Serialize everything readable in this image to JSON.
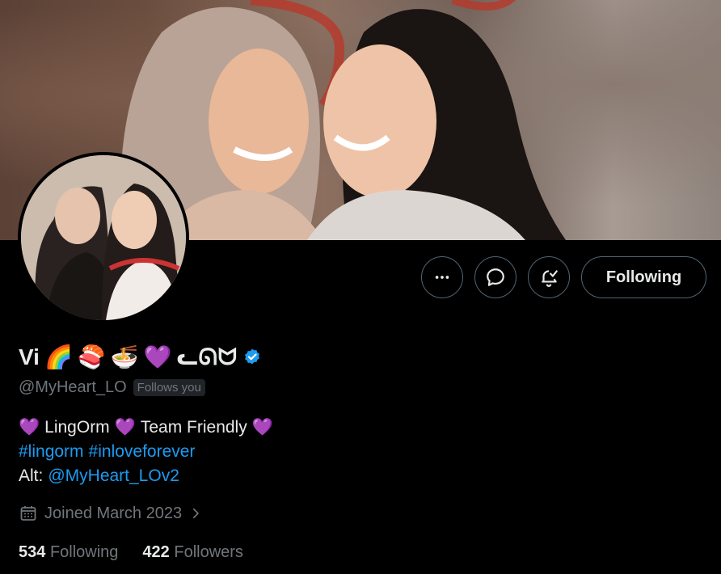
{
  "profile": {
    "name": "Vi",
    "name_emojis": [
      "🌈",
      "🍣",
      "🍜",
      "💜"
    ],
    "name_suffix": "ᓚᘏᗢ",
    "verified": true,
    "handle": "@MyHeart_LO",
    "follows_you": "Follows you",
    "bio": {
      "line1_left_heart": "💜",
      "line1_a": "LingOrm",
      "line1_mid_heart": "💜",
      "line1_b": "Team Friendly",
      "line1_right_heart": "💜",
      "hashtag1": "#lingorm",
      "hashtag2": "#inloveforever",
      "alt_label": "Alt:",
      "alt_handle": "@MyHeart_LOv2"
    },
    "joined": "Joined March 2023",
    "following_count": "534",
    "following_label": "Following",
    "followers_count": "422",
    "followers_label": "Followers"
  },
  "actions": {
    "follow_label": "Following",
    "more_icon": "more-horizontal-icon",
    "message_icon": "message-bubble-icon",
    "notify_icon": "bell-check-icon"
  },
  "colors": {
    "background": "#000000",
    "text": "#e7e9ea",
    "muted": "#71767b",
    "link": "#1d9bf0",
    "border": "#536471"
  }
}
